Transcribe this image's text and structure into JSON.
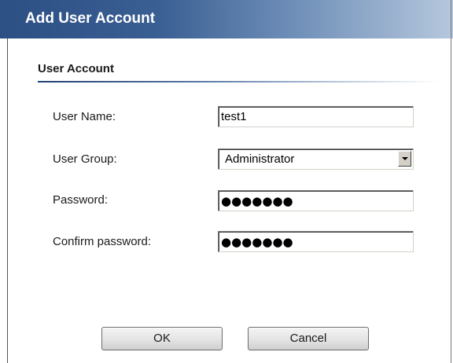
{
  "dialog": {
    "title": "Add User Account",
    "section_title": "User Account"
  },
  "fields": {
    "username": {
      "label": "User Name:",
      "value": "test1"
    },
    "user_group": {
      "label": "User Group:",
      "selected": "Administrator"
    },
    "password": {
      "label": "Password:",
      "masked_value": "●●●●●●●"
    },
    "confirm_password": {
      "label": "Confirm password:",
      "masked_value": "●●●●●●●"
    }
  },
  "buttons": {
    "ok_label": "OK",
    "cancel_label": "Cancel"
  },
  "icons": {
    "dropdown": "chevron-down-icon"
  },
  "colors": {
    "titlebar_start": "#2c4f84",
    "titlebar_end": "#b5c7dd",
    "section_rule": "#1f3f73"
  }
}
